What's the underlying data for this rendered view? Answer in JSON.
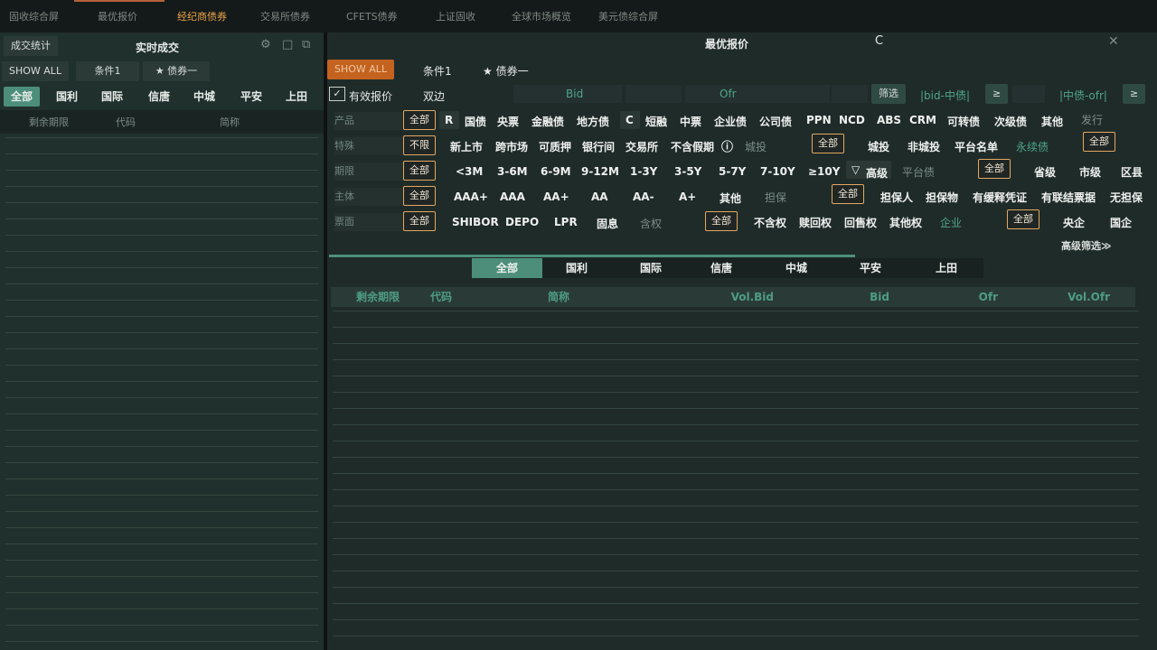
{
  "top_tabs": [
    "固收综合屏",
    "最优报价",
    "经纪商债券",
    "交易所债券",
    "CFETS债券",
    "上证固收",
    "全球市场概览",
    "美元债综合屏"
  ],
  "left": {
    "btn_stats": "成交统计",
    "title": "实时成交",
    "btn_show_all": "SHOW ALL",
    "btn_cond": "条件1",
    "btn_bond": "债券一",
    "segments": [
      "全部",
      "国利",
      "国际",
      "信唐",
      "中城",
      "平安",
      "上田"
    ],
    "columns": [
      "剩余期限",
      "代码",
      "简称"
    ]
  },
  "right": {
    "title": "最优报价",
    "refresh_label": "C",
    "btn_show_all": "SHOW ALL",
    "btn_cond": "条件1",
    "btn_bond": "债券一",
    "valid_quote": "有效报价",
    "two_sided": "双边",
    "bid_label": "Bid",
    "ofr_label": "Ofr",
    "btn_filter": "筛选",
    "bid_mid": "|bid-中债|",
    "mid_ofr": "|中债-ofr|",
    "ge": "≥",
    "filters": {
      "product": {
        "label": "产品",
        "all": "全部",
        "items": [
          "R",
          "国债",
          "央票",
          "金融债",
          "地方债",
          "C",
          "短融",
          "中票",
          "企业债",
          "公司债",
          "PPN",
          "NCD",
          "ABS",
          "CRM",
          "可转债",
          "次级债",
          "其他"
        ],
        "extra": "发行"
      },
      "special": {
        "label": "特殊",
        "all": "不限",
        "items": [
          "新上市",
          "跨市场",
          "可质押",
          "银行间",
          "交易所",
          "不含假期"
        ],
        "info_icon": "ⓘ",
        "sub_label": "城投",
        "sub_all": "全部",
        "sub_items": [
          "城投",
          "非城投",
          "平台名单"
        ],
        "sub2_label": "永续债",
        "sub2_all": "全部"
      },
      "term": {
        "label": "期限",
        "all": "全部",
        "items": [
          "<3M",
          "3-6M",
          "6-9M",
          "9-12M",
          "1-3Y",
          "3-5Y",
          "5-7Y",
          "7-10Y",
          "≥10Y"
        ],
        "advanced": "高级",
        "sub_label": "平台债",
        "sub_all": "全部",
        "sub_items": [
          "省级",
          "市级",
          "区县"
        ]
      },
      "subject": {
        "label": "主体",
        "all": "全部",
        "items": [
          "AAA+",
          "AAA",
          "AA+",
          "AA",
          "AA-",
          "A+",
          "其他"
        ],
        "sub_label": "担保",
        "sub_all": "全部",
        "sub_items": [
          "担保人",
          "担保物",
          "有缓释凭证",
          "有联结票据",
          "无担保"
        ]
      },
      "coupon": {
        "label": "票面",
        "all": "全部",
        "items": [
          "SHIBOR",
          "DEPO",
          "LPR",
          "固息"
        ],
        "sub_label": "含权",
        "sub_all": "全部",
        "sub_items": [
          "不含权",
          "赎回权",
          "回售权",
          "其他权"
        ],
        "sub2_label": "企业",
        "sub2_all": "全部",
        "sub2_items": [
          "央企",
          "国企"
        ]
      }
    },
    "advanced_filter": "高级筛选≫",
    "segments": [
      "全部",
      "国利",
      "国际",
      "信唐",
      "中城",
      "平安",
      "上田"
    ],
    "columns": [
      "剩余期限",
      "代码",
      "简称",
      "Vol.Bid",
      "Bid",
      "Ofr",
      "Vol.Ofr"
    ]
  },
  "colors": {
    "accent_orange": "#e9a34a",
    "accent_green": "#4c8e7a",
    "background": "#1f2b29"
  }
}
